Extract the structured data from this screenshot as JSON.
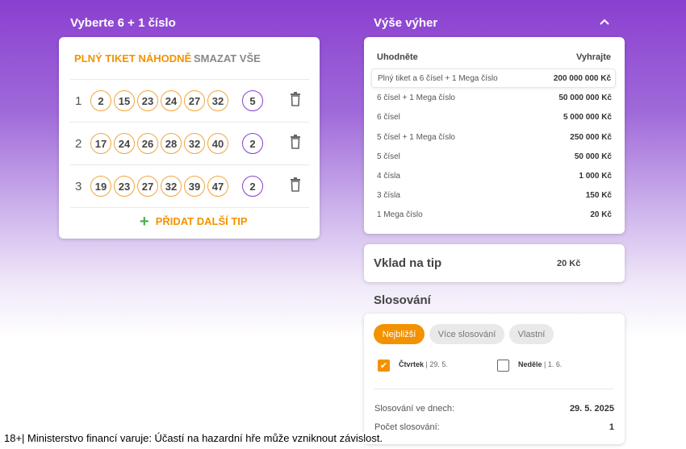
{
  "left": {
    "title": "Vyberte 6 + 1 číslo",
    "random_label": "PLNÝ TIKET NÁHODNĚ",
    "clear_label": "SMAZAT VŠE",
    "tips": [
      {
        "index": "1",
        "numbers": [
          "2",
          "15",
          "23",
          "24",
          "27",
          "32"
        ],
        "mega": "5"
      },
      {
        "index": "2",
        "numbers": [
          "17",
          "24",
          "26",
          "28",
          "32",
          "40"
        ],
        "mega": "2"
      },
      {
        "index": "3",
        "numbers": [
          "19",
          "23",
          "27",
          "32",
          "39",
          "47"
        ],
        "mega": "2"
      }
    ],
    "add_tip_label": "PŘIDAT DALŠÍ TIP"
  },
  "wins": {
    "title": "Výše výher",
    "col_left": "Uhodněte",
    "col_right": "Vyhrajte",
    "rows": [
      {
        "label": "Plný tiket a 6 čísel + 1 Mega číslo",
        "amount": "200 000 000 Kč"
      },
      {
        "label": "6 čísel + 1 Mega číslo",
        "amount": "50 000 000 Kč"
      },
      {
        "label": "6 čísel",
        "amount": "5 000 000 Kč"
      },
      {
        "label": "5 čísel + 1 Mega číslo",
        "amount": "250 000 Kč"
      },
      {
        "label": "5 čísel",
        "amount": "50 000 Kč"
      },
      {
        "label": "4 čísla",
        "amount": "1 000 Kč"
      },
      {
        "label": "3 čísla",
        "amount": "150 Kč"
      },
      {
        "label": "1 Mega číslo",
        "amount": "20 Kč"
      }
    ]
  },
  "stake": {
    "label": "Vklad na tip",
    "value": "20 Kč"
  },
  "draw": {
    "title": "Slosování",
    "chips": [
      "Nejbližší",
      "Více slosování",
      "Vlastní"
    ],
    "days": [
      {
        "day": "Čtvrtek",
        "date": "| 29. 5.",
        "checked": true
      },
      {
        "day": "Neděle",
        "date": "| 1. 6.",
        "checked": false
      }
    ],
    "draw_date_label": "Slosování ve dnech:",
    "draw_date_value": "29. 5. 2025",
    "count_label": "Počet slosování:",
    "count_value": "1"
  },
  "disclaimer": "18+| Ministerstvo financí varuje: Účastí na hazardní hře může vzniknout závislost.",
  "colors": {
    "accent": "#f39200",
    "brand": "#8a3fd0",
    "plus": "#4caf50"
  }
}
